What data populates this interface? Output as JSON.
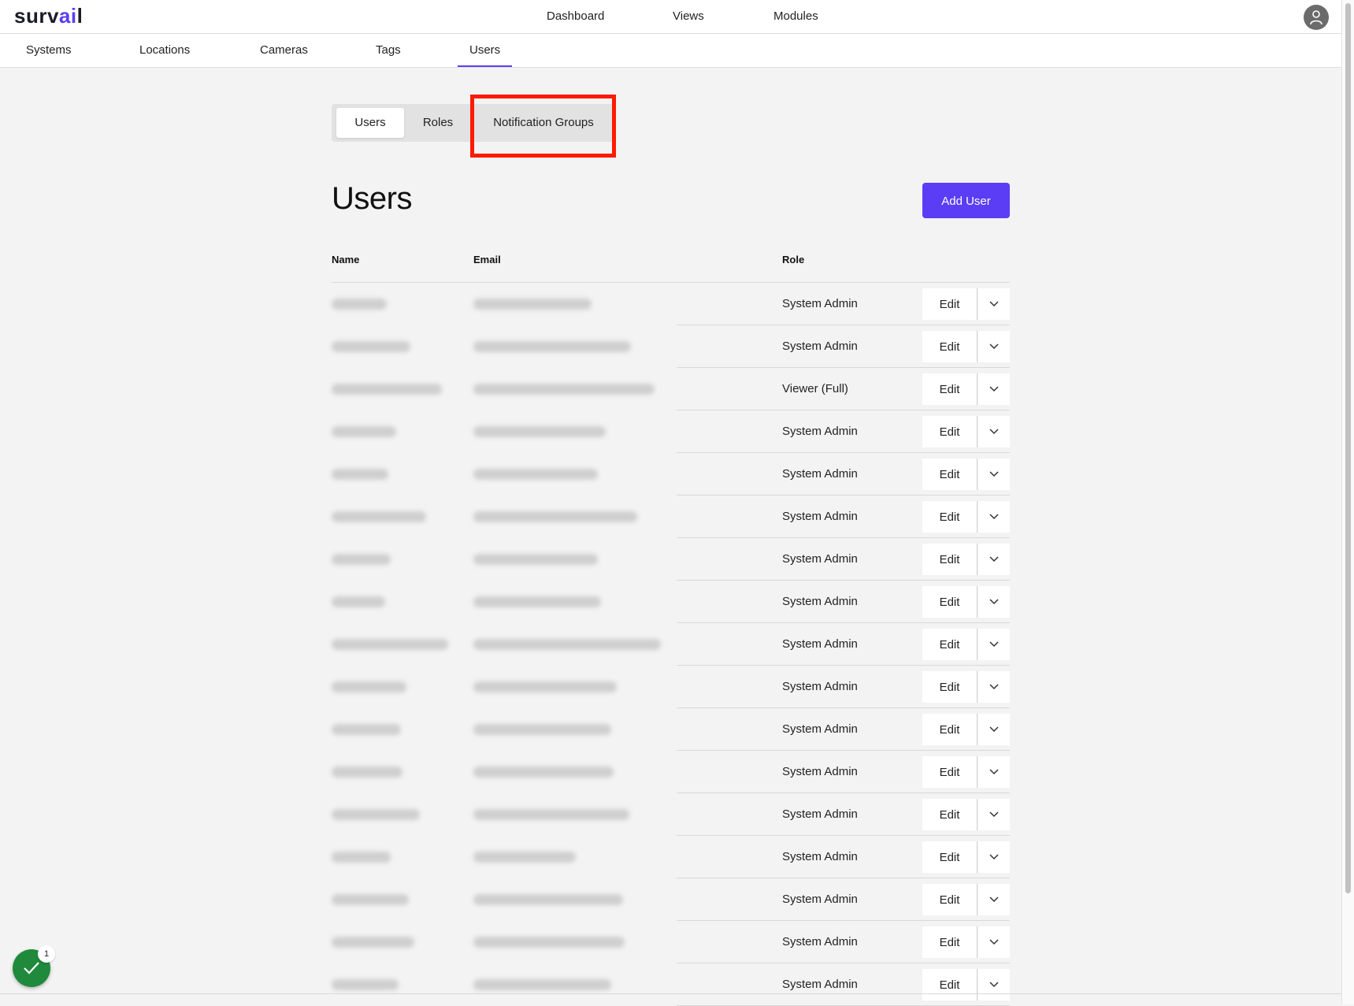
{
  "app": {
    "logo_text_1": "surv",
    "logo_text_2": "ai",
    "logo_text_3": "l",
    "accent_color": "#5b3df5"
  },
  "main_nav": {
    "items": [
      {
        "label": "Dashboard"
      },
      {
        "label": "Views"
      },
      {
        "label": "Modules"
      }
    ],
    "avatar_icon": "user-avatar-icon"
  },
  "sub_nav": {
    "items": [
      {
        "label": "Systems"
      },
      {
        "label": "Locations"
      },
      {
        "label": "Cameras"
      },
      {
        "label": "Tags"
      },
      {
        "label": "Users",
        "active": true
      }
    ]
  },
  "segment_tabs": {
    "items": [
      {
        "label": "Users",
        "active": true
      },
      {
        "label": "Roles"
      },
      {
        "label": "Notification Groups",
        "highlighted": true
      }
    ],
    "highlight_color": "#ff1a00"
  },
  "page": {
    "title": "Users",
    "add_button_label": "Add User"
  },
  "table": {
    "columns": [
      "Name",
      "Email",
      "Role"
    ],
    "edit_label": "Edit",
    "rows": [
      {
        "role": "System Admin"
      },
      {
        "role": "System Admin"
      },
      {
        "role": "Viewer (Full)"
      },
      {
        "role": "System Admin"
      },
      {
        "role": "System Admin"
      },
      {
        "role": "System Admin"
      },
      {
        "role": "System Admin"
      },
      {
        "role": "System Admin"
      },
      {
        "role": "System Admin"
      },
      {
        "role": "System Admin"
      },
      {
        "role": "System Admin"
      },
      {
        "role": "System Admin"
      },
      {
        "role": "System Admin"
      },
      {
        "role": "System Admin"
      },
      {
        "role": "System Admin"
      },
      {
        "role": "System Admin"
      },
      {
        "role": "System Admin"
      }
    ]
  },
  "status_widget": {
    "badge_count": "1",
    "icon": "check-icon",
    "color": "#1f8a3b"
  }
}
